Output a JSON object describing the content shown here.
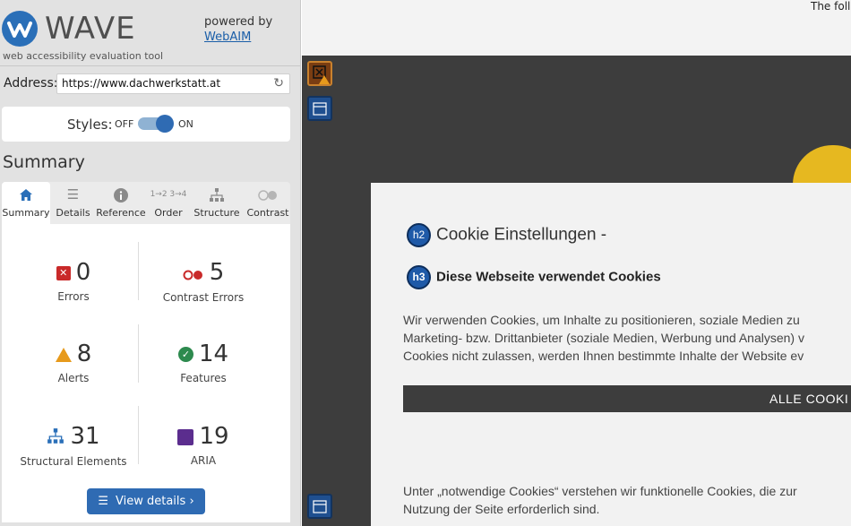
{
  "sidebar": {
    "logo_text": "WAVE",
    "tagline": "web accessibility evaluation tool",
    "powered_by": "powered by",
    "webaim": "WebAIM",
    "address_label": "Address:",
    "address_value": "https://www.dachwerkstatt.at",
    "styles_label": "Styles:",
    "styles_off": "OFF",
    "styles_on": "ON",
    "summary_heading": "Summary",
    "tabs": [
      {
        "label": "Summary",
        "icon": "home-icon"
      },
      {
        "label": "Details",
        "icon": "list-icon"
      },
      {
        "label": "Reference",
        "icon": "info-icon"
      },
      {
        "label": "Order",
        "icon": "order-icon"
      },
      {
        "label": "Structure",
        "icon": "structure-icon"
      },
      {
        "label": "Contrast",
        "icon": "contrast-icon"
      }
    ],
    "stats": {
      "errors": {
        "value": "0",
        "label": "Errors"
      },
      "contrast_errors": {
        "value": "5",
        "label": "Contrast Errors"
      },
      "alerts": {
        "value": "8",
        "label": "Alerts"
      },
      "features": {
        "value": "14",
        "label": "Features"
      },
      "structural": {
        "value": "31",
        "label": "Structural Elements"
      },
      "aria": {
        "value": "19",
        "label": "ARIA"
      }
    },
    "view_details": "View details ›"
  },
  "page": {
    "top_text": "The foll",
    "h2_badge": "h2",
    "h2_text": "Cookie Einstellungen -",
    "h3_badge": "h3",
    "h3_text": "Diese Webseite verwendet Cookies",
    "para_lines": [
      "Wir verwenden Cookies, um Inhalte zu positionieren, soziale Medien zu",
      "Marketing- bzw. Drittanbieter (soziale Medien, Werbung und Analysen) v",
      "Cookies nicht zulassen, werden Ihnen bestimmte Inhalte der Website ev"
    ],
    "accept_button": "ALLE COOKI",
    "para2_lines": [
      "Unter „notwendige Cookies“ verstehen wir funktionelle Cookies, die zur",
      "Nutzung der Seite erforderlich sind."
    ]
  },
  "colors": {
    "brand_blue": "#2f6bb3",
    "error_red": "#c92a2a",
    "alert_orange": "#e79a1c",
    "feature_green": "#2d8a4e",
    "aria_purple": "#5b2d8e",
    "page_dark": "#3d3d3d"
  }
}
